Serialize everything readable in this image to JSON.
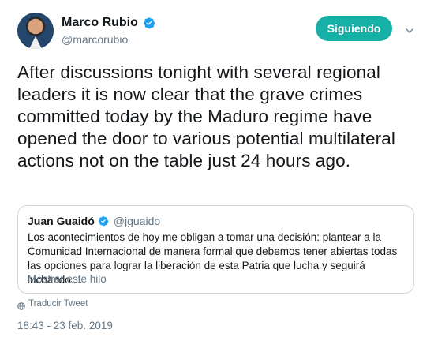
{
  "author": {
    "display_name": "Marco Rubio",
    "handle": "@marcorubio"
  },
  "follow_button": {
    "label": "Siguiendo",
    "color": "#17b0a7"
  },
  "tweet": {
    "text": "After discussions tonight with several regional leaders it is now clear that the grave crimes committed today by the Maduro regime have opened the door to various potential multilateral actions not on the table just 24 hours ago."
  },
  "quote": {
    "display_name": "Juan Guaidó",
    "handle": "@jguaido",
    "text": "Los acontecimientos de hoy me obligan a tomar una decisión: plantear a la Comunidad Internacional de manera formal que debemos tener abiertas todas las opciones para lograr la liberación de esta Patria que lucha y seguirá luchando....",
    "show_thread_label": "Mostrar este hilo"
  },
  "translate_label": "Traducir Tweet",
  "timestamp": "18:43 - 23 feb. 2019",
  "colors": {
    "verified": "#1da1f2",
    "secondary_text": "#657786",
    "border": "#ccd6dd"
  },
  "icons": [
    "verified-badge-icon",
    "chevron-down-icon",
    "globe-icon"
  ]
}
